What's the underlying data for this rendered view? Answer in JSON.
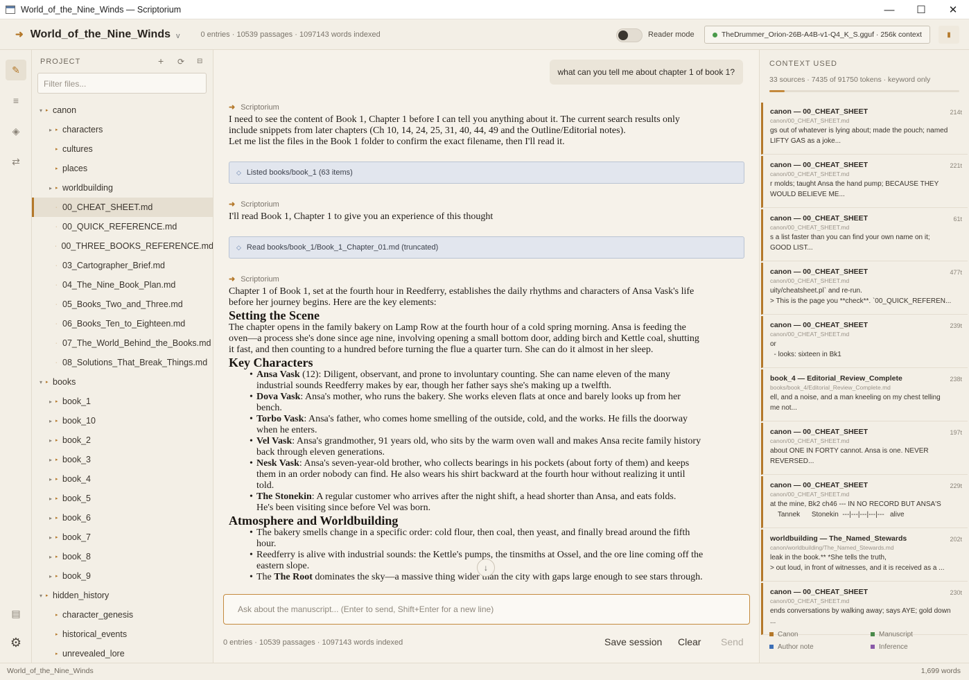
{
  "window": {
    "title": "World_of_the_Nine_Winds — Scriptorium"
  },
  "header": {
    "project_name": "World_of_the_Nine_Winds",
    "stats": "0 entries · 10539 passages · 1097143 words indexed",
    "reader_mode_label": "Reader mode",
    "reader_mode_on": false,
    "model": "TheDrummer_Orion-26B-A4B-v1-Q4_K_S.gguf · 256k context"
  },
  "sidebar": {
    "heading": "PROJECT",
    "filter_placeholder": "Filter files...",
    "tree": [
      {
        "label": "canon",
        "level": 0,
        "type": "folder",
        "open": true
      },
      {
        "label": "characters",
        "level": 1,
        "type": "folder"
      },
      {
        "label": "cultures",
        "level": 1,
        "type": "folder-leaf"
      },
      {
        "label": "places",
        "level": 1,
        "type": "folder-leaf"
      },
      {
        "label": "worldbuilding",
        "level": 1,
        "type": "folder"
      },
      {
        "label": "00_CHEAT_SHEET.md",
        "level": 1,
        "type": "file",
        "selected": true
      },
      {
        "label": "00_QUICK_REFERENCE.md",
        "level": 1,
        "type": "file"
      },
      {
        "label": "00_THREE_BOOKS_REFERENCE.md",
        "level": 1,
        "type": "file"
      },
      {
        "label": "03_Cartographer_Brief.md",
        "level": 1,
        "type": "file"
      },
      {
        "label": "04_The_Nine_Book_Plan.md",
        "level": 1,
        "type": "file"
      },
      {
        "label": "05_Books_Two_and_Three.md",
        "level": 1,
        "type": "file"
      },
      {
        "label": "06_Books_Ten_to_Eighteen.md",
        "level": 1,
        "type": "file"
      },
      {
        "label": "07_The_World_Behind_the_Books.md",
        "level": 1,
        "type": "file"
      },
      {
        "label": "08_Solutions_That_Break_Things.md",
        "level": 1,
        "type": "file"
      },
      {
        "label": "books",
        "level": 0,
        "type": "folder",
        "open": true
      },
      {
        "label": "book_1",
        "level": 1,
        "type": "folder"
      },
      {
        "label": "book_10",
        "level": 1,
        "type": "folder"
      },
      {
        "label": "book_2",
        "level": 1,
        "type": "folder"
      },
      {
        "label": "book_3",
        "level": 1,
        "type": "folder"
      },
      {
        "label": "book_4",
        "level": 1,
        "type": "folder"
      },
      {
        "label": "book_5",
        "level": 1,
        "type": "folder"
      },
      {
        "label": "book_6",
        "level": 1,
        "type": "folder"
      },
      {
        "label": "book_7",
        "level": 1,
        "type": "folder"
      },
      {
        "label": "book_8",
        "level": 1,
        "type": "folder"
      },
      {
        "label": "book_9",
        "level": 1,
        "type": "folder"
      },
      {
        "label": "hidden_history",
        "level": 0,
        "type": "folder",
        "open": true
      },
      {
        "label": "character_genesis",
        "level": 1,
        "type": "folder-leaf"
      },
      {
        "label": "historical_events",
        "level": 1,
        "type": "folder-leaf"
      },
      {
        "label": "unrevealed_lore",
        "level": 1,
        "type": "folder-leaf"
      }
    ]
  },
  "chat": {
    "user_message": "what can you tell me about chapter 1 of book 1?",
    "assistant_name": "Scriptorium",
    "msg1": [
      "I need to see the content of Book 1, Chapter 1 before I can tell you anything about it. The current search results only",
      "include snippets from later chapters (Ch 10, 14, 24, 25, 31, 40, 44, 49 and the Outline/Editorial notes).",
      "Let me list the files in the Book 1 folder to confirm the exact filename, then I'll read it."
    ],
    "tool1": "Listed books/book_1 (63 items)",
    "msg2": "I'll read Book 1, Chapter 1 to give you an experience of this thought",
    "tool2": "Read books/book_1/Book_1_Chapter_01.md (truncated)",
    "answer": {
      "intro": [
        "Chapter 1 of Book 1, set at the fourth hour in Reedferry, establishes the daily rhythms and characters of Ansa Vask's life",
        "before her journey begins. Here are the key elements:"
      ],
      "h_scene": "Setting the Scene",
      "scene": [
        "The chapter opens in the family bakery on Lamp Row at the fourth hour of a cold spring morning. Ansa is feeding the",
        "oven—a process she's done since age nine, involving opening a small bottom door, adding birch and Kettle coal, shutting",
        "it fast, and then counting to a hundred before turning the flue a quarter turn. She can do it almost in her sleep."
      ],
      "h_chars": "Key Characters",
      "chars": [
        {
          "name": "Ansa Vask",
          "text": [
            " (12): Diligent, observant, and prone to involuntary counting. She can name eleven of the many",
            "industrial sounds Reedferry makes by ear, though her father says she's making up a twelfth."
          ]
        },
        {
          "name": "Dova Vask",
          "text": [
            ": Ansa's mother, who runs the bakery. She works eleven flats at once and barely looks up from her",
            "bench."
          ]
        },
        {
          "name": "Torbo Vask",
          "text": [
            ": Ansa's father, who comes home smelling of the outside, cold, and the works. He fills the doorway",
            "when he enters."
          ]
        },
        {
          "name": "Vel Vask",
          "text": [
            ": Ansa's grandmother, 91 years old, who sits by the warm oven wall and makes Ansa recite family history",
            "back through eleven generations."
          ]
        },
        {
          "name": "Nesk Vask",
          "text": [
            ": Ansa's seven-year-old brother, who collects bearings in his pockets (about forty of them) and keeps",
            "them in an order nobody can find. He also wears his shirt backward at the fourth hour without realizing it until",
            "told."
          ]
        },
        {
          "name": "The Stonekin",
          "text": [
            ": A regular customer who arrives after the night shift, a head shorter than Ansa, and eats folds.",
            "He's been visiting since before Vel was born."
          ]
        }
      ],
      "h_atmo": "Atmosphere and Worldbuilding",
      "atmo": [
        {
          "bold": "",
          "text": [
            "The bakery smells change in a specific order: cold flour, then coal, then yeast, and finally bread around the fifth",
            "hour."
          ]
        },
        {
          "bold": "",
          "text": [
            "Reedferry is alive with industrial sounds: the Kettle's pumps, the tinsmiths at Ossel, and the ore line coming off the",
            "eastern slope."
          ]
        },
        {
          "bold": "The Root",
          "pre": "The ",
          "text": [
            " dominates the sky—a massive thing wider than the city with gaps large enough to see stars through."
          ]
        }
      ]
    },
    "composer_placeholder": "Ask about the manuscript...   (Enter to send, Shift+Enter for a new line)",
    "foot_stats": "0 entries · 10539 passages · 1097143 words indexed",
    "save_label": "Save session",
    "clear_label": "Clear",
    "send_label": "Send"
  },
  "context": {
    "heading": "CONTEXT USED",
    "summary": "33 sources · 7435 of 91750 tokens · keyword only",
    "usage_fraction": 0.081,
    "sources": [
      {
        "title": "canon — 00_CHEAT_SHEET",
        "tokens": "214t",
        "path": "canon/00_CHEAT_SHEET.md",
        "snippet": "gs out of whatever is lying about; made the pouch; named\nLIFTY GAS as a joke..."
      },
      {
        "title": "canon — 00_CHEAT_SHEET",
        "tokens": "221t",
        "path": "canon/00_CHEAT_SHEET.md",
        "snippet": "r molds; taught Ansa the hand pump; BECAUSE THEY\nWOULD BELIEVE ME..."
      },
      {
        "title": "canon — 00_CHEAT_SHEET",
        "tokens": "61t",
        "path": "canon/00_CHEAT_SHEET.md",
        "snippet": "s a list faster than you can find your own name on it;\nGOOD LIST..."
      },
      {
        "title": "canon — 00_CHEAT_SHEET",
        "tokens": "477t",
        "path": "canon/00_CHEAT_SHEET.md",
        "snippet": "uity/cheatsheet.pl` and re-run.\n> This is the page you **check**. `00_QUICK_REFEREN..."
      },
      {
        "title": "canon — 00_CHEAT_SHEET",
        "tokens": "239t",
        "path": "canon/00_CHEAT_SHEET.md",
        "snippet": "or\n  - looks: sixteen in Bk1"
      },
      {
        "title": "book_4 — Editorial_Review_Complete",
        "tokens": "238t",
        "path": "books/book_4/Editorial_Review_Complete.md",
        "snippet": "ell, and a noise, and a man kneeling on my chest telling\nme not..."
      },
      {
        "title": "canon — 00_CHEAT_SHEET",
        "tokens": "197t",
        "path": "canon/00_CHEAT_SHEET.md",
        "snippet": "about ONE IN FORTY cannot. Ansa is one. NEVER\nREVERSED..."
      },
      {
        "title": "canon — 00_CHEAT_SHEET",
        "tokens": "229t",
        "path": "canon/00_CHEAT_SHEET.md",
        "snippet": "at the mine, Bk2 ch46 --- IN NO RECORD BUT ANSA'S\n    Tannek      Stonekin  ---|---|---|---|---   alive"
      },
      {
        "title": "worldbuilding — The_Named_Stewards",
        "tokens": "202t",
        "path": "canon/worldbuilding/The_Named_Stewards.md",
        "snippet": "leak in the book.** *She tells the truth,\n> out loud, in front of witnesses, and it is received as a ..."
      },
      {
        "title": "canon — 00_CHEAT_SHEET",
        "tokens": "230t",
        "path": "canon/00_CHEAT_SHEET.md",
        "snippet": "ends conversations by walking away; says AYE; gold down\n..."
      }
    ],
    "legend": [
      {
        "label": "Canon",
        "color": "#b4782a"
      },
      {
        "label": "Manuscript",
        "color": "#4a8a4a"
      },
      {
        "label": "Author note",
        "color": "#3d6fb6"
      },
      {
        "label": "Inference",
        "color": "#8a5aa8"
      }
    ]
  },
  "status": {
    "project": "World_of_the_Nine_Winds",
    "words": "1,699 words"
  }
}
